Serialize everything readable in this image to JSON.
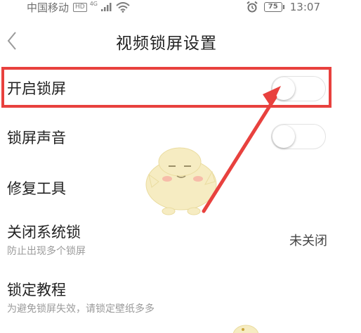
{
  "status_bar": {
    "carrier": "中国移动",
    "hd_badge": "HD",
    "network_type": "4G",
    "battery_level": "75",
    "time": "13:07",
    "icons": [
      "signal-icon",
      "wifi-icon",
      "alarm-icon",
      "battery-icon"
    ]
  },
  "nav": {
    "back_icon": "chevron-left-icon",
    "title": "视频锁屏设置"
  },
  "settings": {
    "enable_lock_screen": {
      "label": "开启锁屏",
      "toggle_on": false
    },
    "lock_screen_sound": {
      "label": "锁屏声音",
      "toggle_on": false
    },
    "repair_tools": {
      "label": "修复工具"
    },
    "close_system_lock": {
      "label": "关闭系统锁",
      "subtitle": "防止出现多个锁屏",
      "value": "未关闭"
    },
    "lock_tutorial": {
      "label": "锁定教程",
      "subtitle": "为避免锁屏失效，请锁定壁纸多多"
    }
  },
  "annotation": {
    "highlight_color": "#e8413e",
    "arrow_color": "#e8413e"
  },
  "theme": {
    "text_primary": "#222222",
    "text_secondary": "#9a9a9a",
    "mascot_color": "#f6ecc2"
  }
}
